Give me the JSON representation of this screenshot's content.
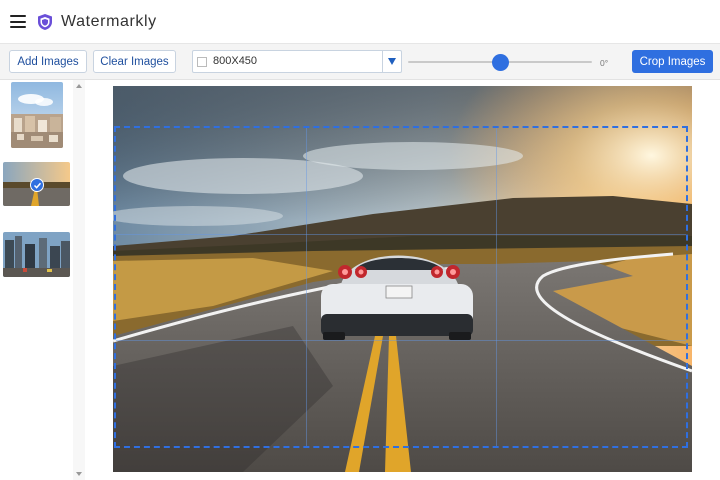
{
  "app": {
    "title": "Watermarkly"
  },
  "toolbar": {
    "add_images_label": "Add Images",
    "clear_images_label": "Clear Images",
    "size_select_value": "800X450",
    "angle_label": "0°",
    "rotation_level": 0.5,
    "crop_images_label": "Crop Images"
  },
  "sidebar": {
    "thumbnails": [
      {
        "name": "city-thumbnail",
        "selected": false
      },
      {
        "name": "car-road-thumbnail",
        "selected": true
      },
      {
        "name": "street-thumbnail",
        "selected": false
      }
    ]
  },
  "colors": {
    "accent": "#2f6fe0",
    "button_text": "#1f4f9e"
  }
}
